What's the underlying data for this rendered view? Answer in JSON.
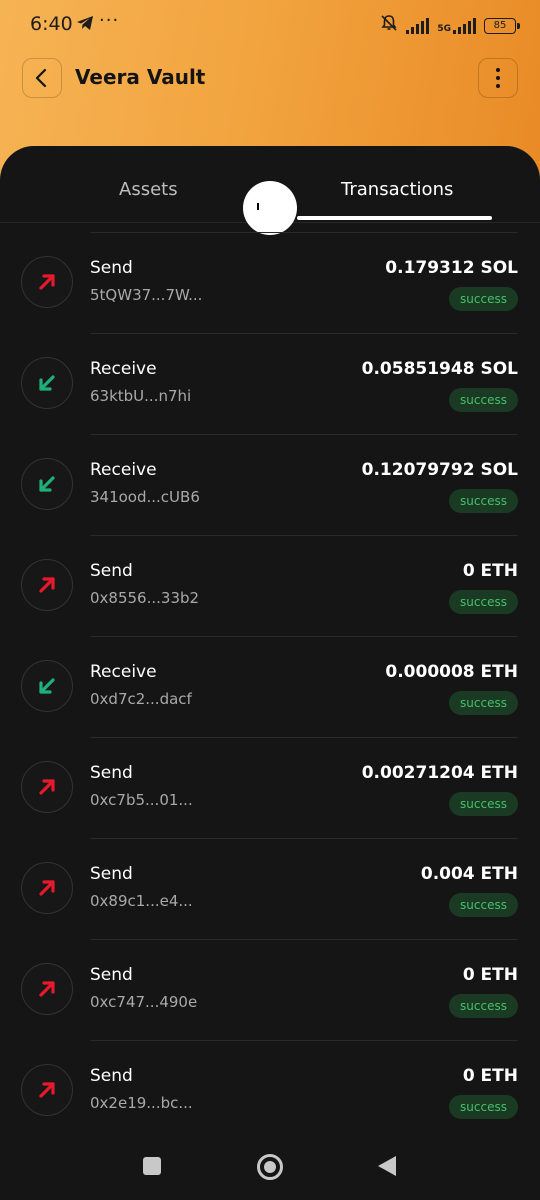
{
  "status_bar": {
    "time": "6:40",
    "more": "···",
    "battery": "85",
    "network": "5G"
  },
  "header": {
    "title": "Veera Vault"
  },
  "tabs": [
    {
      "label": "Assets",
      "active": false
    },
    {
      "label": "Transactions",
      "active": true
    }
  ],
  "transactions": [
    {
      "type": "Send",
      "hash": "5tQW37...7W...",
      "amount": "0.179312 SOL",
      "status": "success",
      "direction": "out"
    },
    {
      "type": "Receive",
      "hash": "63ktbU...n7hi",
      "amount": "0.05851948 SOL",
      "status": "success",
      "direction": "in"
    },
    {
      "type": "Receive",
      "hash": "341ood...cUB6",
      "amount": "0.12079792 SOL",
      "status": "success",
      "direction": "in"
    },
    {
      "type": "Send",
      "hash": "0x8556...33b2",
      "amount": "0 ETH",
      "status": "success",
      "direction": "out"
    },
    {
      "type": "Receive",
      "hash": "0xd7c2...dacf",
      "amount": "0.000008 ETH",
      "status": "success",
      "direction": "in"
    },
    {
      "type": "Send",
      "hash": "0xc7b5...01...",
      "amount": "0.00271204 ETH",
      "status": "success",
      "direction": "out"
    },
    {
      "type": "Send",
      "hash": "0x89c1...e4...",
      "amount": "0.004 ETH",
      "status": "success",
      "direction": "out"
    },
    {
      "type": "Send",
      "hash": "0xc747...490e",
      "amount": "0 ETH",
      "status": "success",
      "direction": "out"
    },
    {
      "type": "Send",
      "hash": "0x2e19...bc...",
      "amount": "0 ETH",
      "status": "success",
      "direction": "out"
    }
  ],
  "colors": {
    "send": "#e8192c",
    "receive": "#1fb07a",
    "accent": "#f2a43f"
  },
  "icons": {
    "send": "arrow-up-right-icon",
    "receive": "arrow-down-left-icon"
  }
}
